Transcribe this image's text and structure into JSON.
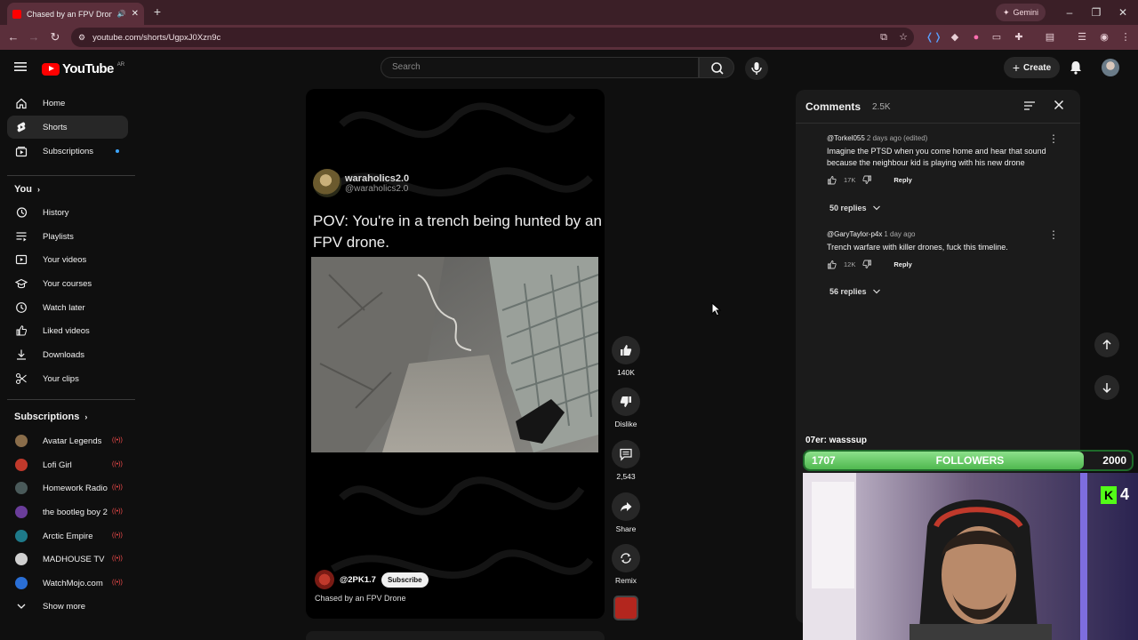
{
  "browser": {
    "tab_title": "Chased by an FPV Drone - YouTube",
    "new_tab": "+",
    "gemini_label": "Gemini",
    "url": "youtube.com/shorts/UgpxJ0Xzn9c"
  },
  "header": {
    "logo_text": "YouTube",
    "logo_region": "AR",
    "search_placeholder": "Search",
    "create_label": "Create"
  },
  "sidebar": {
    "main": [
      {
        "label": "Home",
        "icon": "home-icon"
      },
      {
        "label": "Shorts",
        "icon": "shorts-icon"
      },
      {
        "label": "Subscriptions",
        "icon": "subscriptions-icon"
      }
    ],
    "you_heading": "You",
    "you_items": [
      {
        "label": "History",
        "icon": "history-icon"
      },
      {
        "label": "Playlists",
        "icon": "playlists-icon"
      },
      {
        "label": "Your videos",
        "icon": "your-videos-icon"
      },
      {
        "label": "Your courses",
        "icon": "courses-icon"
      },
      {
        "label": "Watch later",
        "icon": "watch-later-icon"
      },
      {
        "label": "Liked videos",
        "icon": "like-icon"
      },
      {
        "label": "Downloads",
        "icon": "download-icon"
      },
      {
        "label": "Your clips",
        "icon": "scissors-icon"
      }
    ],
    "subs_heading": "Subscriptions",
    "subs": [
      {
        "label": "Avatar Legends",
        "color": "#8a6d4a"
      },
      {
        "label": "Lofi Girl",
        "color": "#c0392b"
      },
      {
        "label": "Homework Radio",
        "color": "#4a5a5a"
      },
      {
        "label": "the bootleg boy 2",
        "color": "#6a3d9a"
      },
      {
        "label": "Arctic Empire",
        "color": "#1e7a8a"
      },
      {
        "label": "MADHOUSE TV",
        "color": "#d0d0d0"
      },
      {
        "label": "WatchMojo.com",
        "color": "#2a6fd6"
      }
    ],
    "show_more": "Show more"
  },
  "short": {
    "overlay_channel_name": "waraholics2.0",
    "overlay_channel_handle": "@waraholics2.0",
    "overlay_caption": "POV: You're in a trench being hunted by an FPV drone.",
    "channel_handle": "@2PK1.7",
    "subscribe_label": "Subscribe",
    "title": "Chased by an FPV Drone"
  },
  "actions": {
    "likes": "140K",
    "dislike_label": "Dislike",
    "comments": "2,543",
    "share_label": "Share",
    "remix_label": "Remix"
  },
  "comments": {
    "title": "Comments",
    "count": "2.5K",
    "items": [
      {
        "author": "@Torkel055",
        "time": "2 days ago (edited)",
        "text": "Imagine the PTSD when you come home and hear that sound because the neighbour kid is playing with his new drone",
        "likes": "17K",
        "reply_label": "Reply",
        "replies": "50 replies"
      },
      {
        "author": "@GaryTaylor-p4x",
        "time": "1 day ago",
        "text": "Trench warfare with killer drones, fuck this timeline.",
        "likes": "12K",
        "reply_label": "Reply",
        "replies": "56 replies"
      }
    ]
  },
  "stream_overlay": {
    "chat_line": "07er: wasssup",
    "followers_current": "1707",
    "followers_label": "FOLLOWERS",
    "followers_goal": "2000",
    "followers_progress": 0.8535,
    "kick_letter": "K",
    "kick_count": "4"
  }
}
